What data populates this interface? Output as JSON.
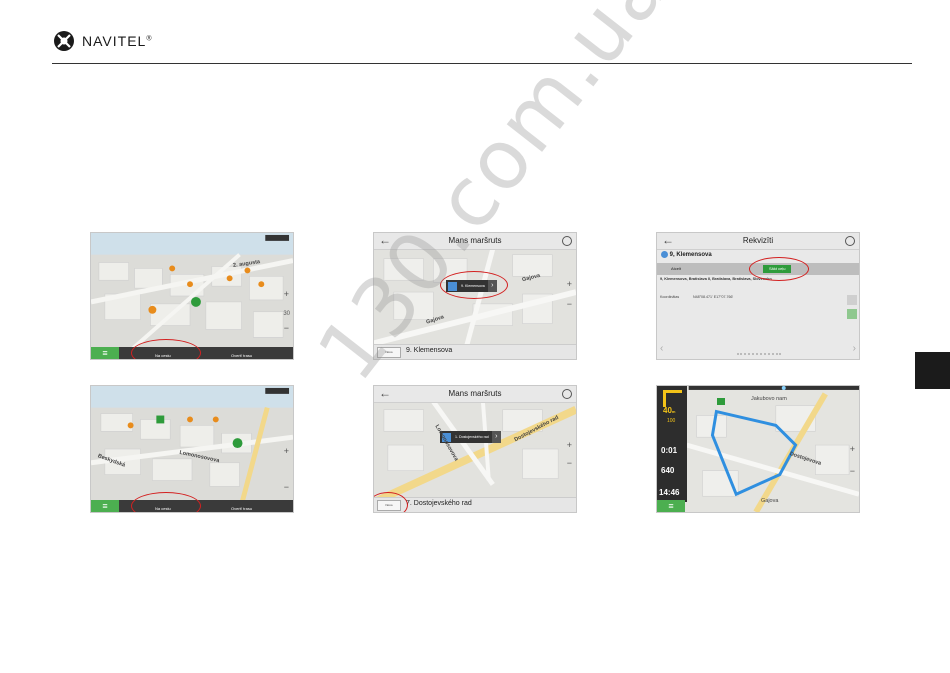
{
  "header": {
    "brand": "NAVITEL",
    "reg_mark": "®"
  },
  "watermark": "130.com.ua",
  "screens": {
    "s1": {
      "street": "2. augusta",
      "button_label": "Na cestu",
      "right_label": "Overiť trasu",
      "zoom_value": "30"
    },
    "s2": {
      "street": "Lomonosovova",
      "street2": "Beskydská",
      "button_label": "Na cestu",
      "right_label": "Overiť trasu"
    },
    "s3": {
      "title": "Mans maršruts",
      "popup": "9. Klemensova",
      "street": "Gajova",
      "street2": "Gajova",
      "bottom_icon": "Novo",
      "bottom_addr": "9. Klemensova"
    },
    "s4": {
      "title": "Mans maršruts",
      "popup": "1. Dostojevského rad",
      "street": "Dostojevského rad",
      "street2": "Lomonosovova",
      "bottom_icon": "Novo",
      "bottom_addr": "7. Dostojevského rad"
    },
    "s5": {
      "title": "Rekvizīti",
      "name": "9, Klemensova",
      "button1": "Atcelt",
      "button2": "Sākt ceļu",
      "address": "9, Klemensova, Bratislava II, Bratislava, Bratislava, Slovensko",
      "coords_label": "Koordinātas",
      "coords_value": "N48°08.471' E17°07.766'"
    },
    "s6": {
      "distance": "40",
      "dist_unit": "m",
      "speed": "100",
      "time1": "0:01",
      "dist2": "640",
      "clock": "14:46",
      "street_top": "Jakubovo nam",
      "street_mid": "Dostojevova",
      "street_bot": "Gajova"
    }
  }
}
